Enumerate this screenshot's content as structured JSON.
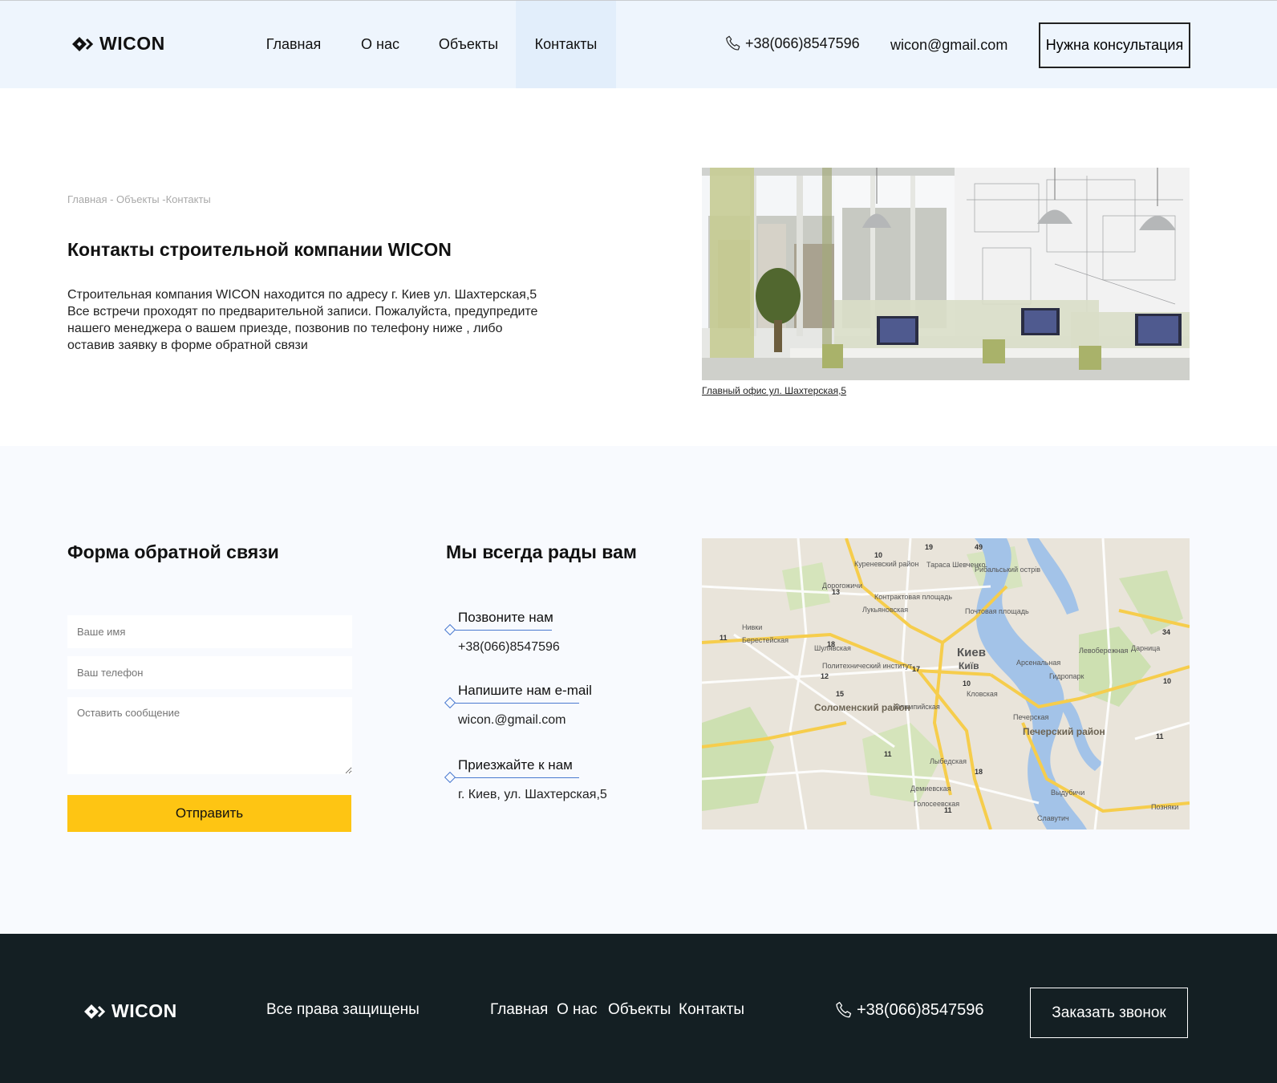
{
  "header": {
    "logo_text": "WICON",
    "nav": [
      {
        "label": "Главная",
        "active": false
      },
      {
        "label": "О нас",
        "active": false
      },
      {
        "label": "Объекты",
        "active": false
      },
      {
        "label": "Контакты",
        "active": true
      }
    ],
    "phone": "+38(066)8547596",
    "email": "wicon@gmail.com",
    "consult_button": "Нужна консультация"
  },
  "intro": {
    "breadcrumb": "Главная - Объекты -Контакты",
    "title": "Контакты строительной компании WICON",
    "paragraph_1": "Строительная компания WICON находится по адресу г. Киев ул. Шахтерская,5",
    "paragraph_2": "Все встречи проходят по предварительной записи. Пожалуйста, предупредите нашего менеджера о вашем приезде, позвонив по телефону ниже , либо оставив заявку в форме обратной связи",
    "photo_caption": "Главный офис ул. Шахтерская,5"
  },
  "form": {
    "title": "Форма обратной связи",
    "name_placeholder": "Ваше имя",
    "phone_placeholder": "Ваш телефон",
    "message_placeholder": "Оставить сообщение",
    "submit_label": "Отправить"
  },
  "contacts": {
    "title": "Мы всегда рады вам",
    "items": [
      {
        "label": "Позвоните нам",
        "value": "+38(066)8547596"
      },
      {
        "label": "Напишите нам e-mail",
        "value": "wicon.@gmail.com"
      },
      {
        "label": "Приезжайте к нам",
        "value": "г. Киев, ул. Шахтерская,5"
      }
    ]
  },
  "map": {
    "city_label": "Киев",
    "city_label_uk": "Київ",
    "districts": [
      "Соломенский район",
      "Печерский район",
      "Шулявская",
      "Лукьяновская",
      "Почтовая площадь",
      "Арсенальная",
      "Кловская",
      "Печерская",
      "Олимпийская",
      "Лыбедская",
      "Демиевская",
      "Голосеевская",
      "Политехнический институт",
      "Берестейская",
      "Нивки",
      "Дорогожичи",
      "Левобережная",
      "Гидропарк",
      "Дарница",
      "Позняки",
      "Выдубичи",
      "Славутич",
      "Рибальський острів",
      "Контрактовая площадь",
      "Тараса Шевченко",
      "Куреневский район"
    ],
    "road_numbers": [
      "19",
      "49",
      "10",
      "13",
      "18",
      "17",
      "12",
      "15",
      "10",
      "11",
      "11",
      "18",
      "11",
      "34",
      "10",
      "11"
    ],
    "colors": {
      "land": "#e9e4da",
      "water": "#a3c3e8",
      "park": "#c6dfa6",
      "major_road": "#f6cd4c",
      "road": "#ffffff"
    }
  },
  "footer": {
    "logo_text": "WICON",
    "rights": "Все права защищены",
    "nav": [
      "Главная",
      "О нас",
      "Объекты",
      "Контакты"
    ],
    "phone": "+38(066)8547596",
    "callback_button": "Заказать звонок"
  },
  "colors": {
    "header_bg": "#eef5fd",
    "nav_active_bg": "#e2eefb",
    "section_bg": "#f8fafe",
    "accent_yellow": "#fec513",
    "accent_blue": "#4a7ad0",
    "footer_bg": "#141f23"
  }
}
